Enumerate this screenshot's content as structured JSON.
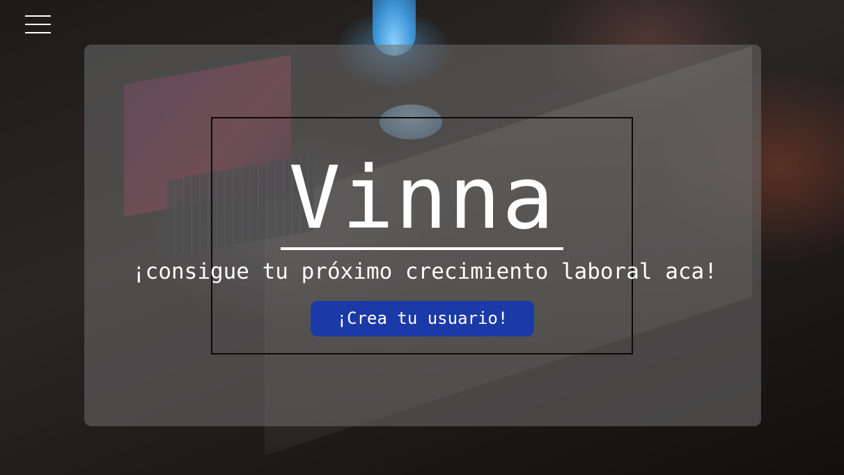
{
  "header": {
    "menu_icon": "hamburger-menu-icon"
  },
  "hero": {
    "brand": "Vinna",
    "tagline": "¡consigue tu próximo crecimiento laboral aca!",
    "cta_label": "¡Crea tu usuario!"
  },
  "colors": {
    "cta_background": "#1b3aa8",
    "text": "#ffffff",
    "panel_overlay": "rgba(110,110,110,0.55)"
  }
}
